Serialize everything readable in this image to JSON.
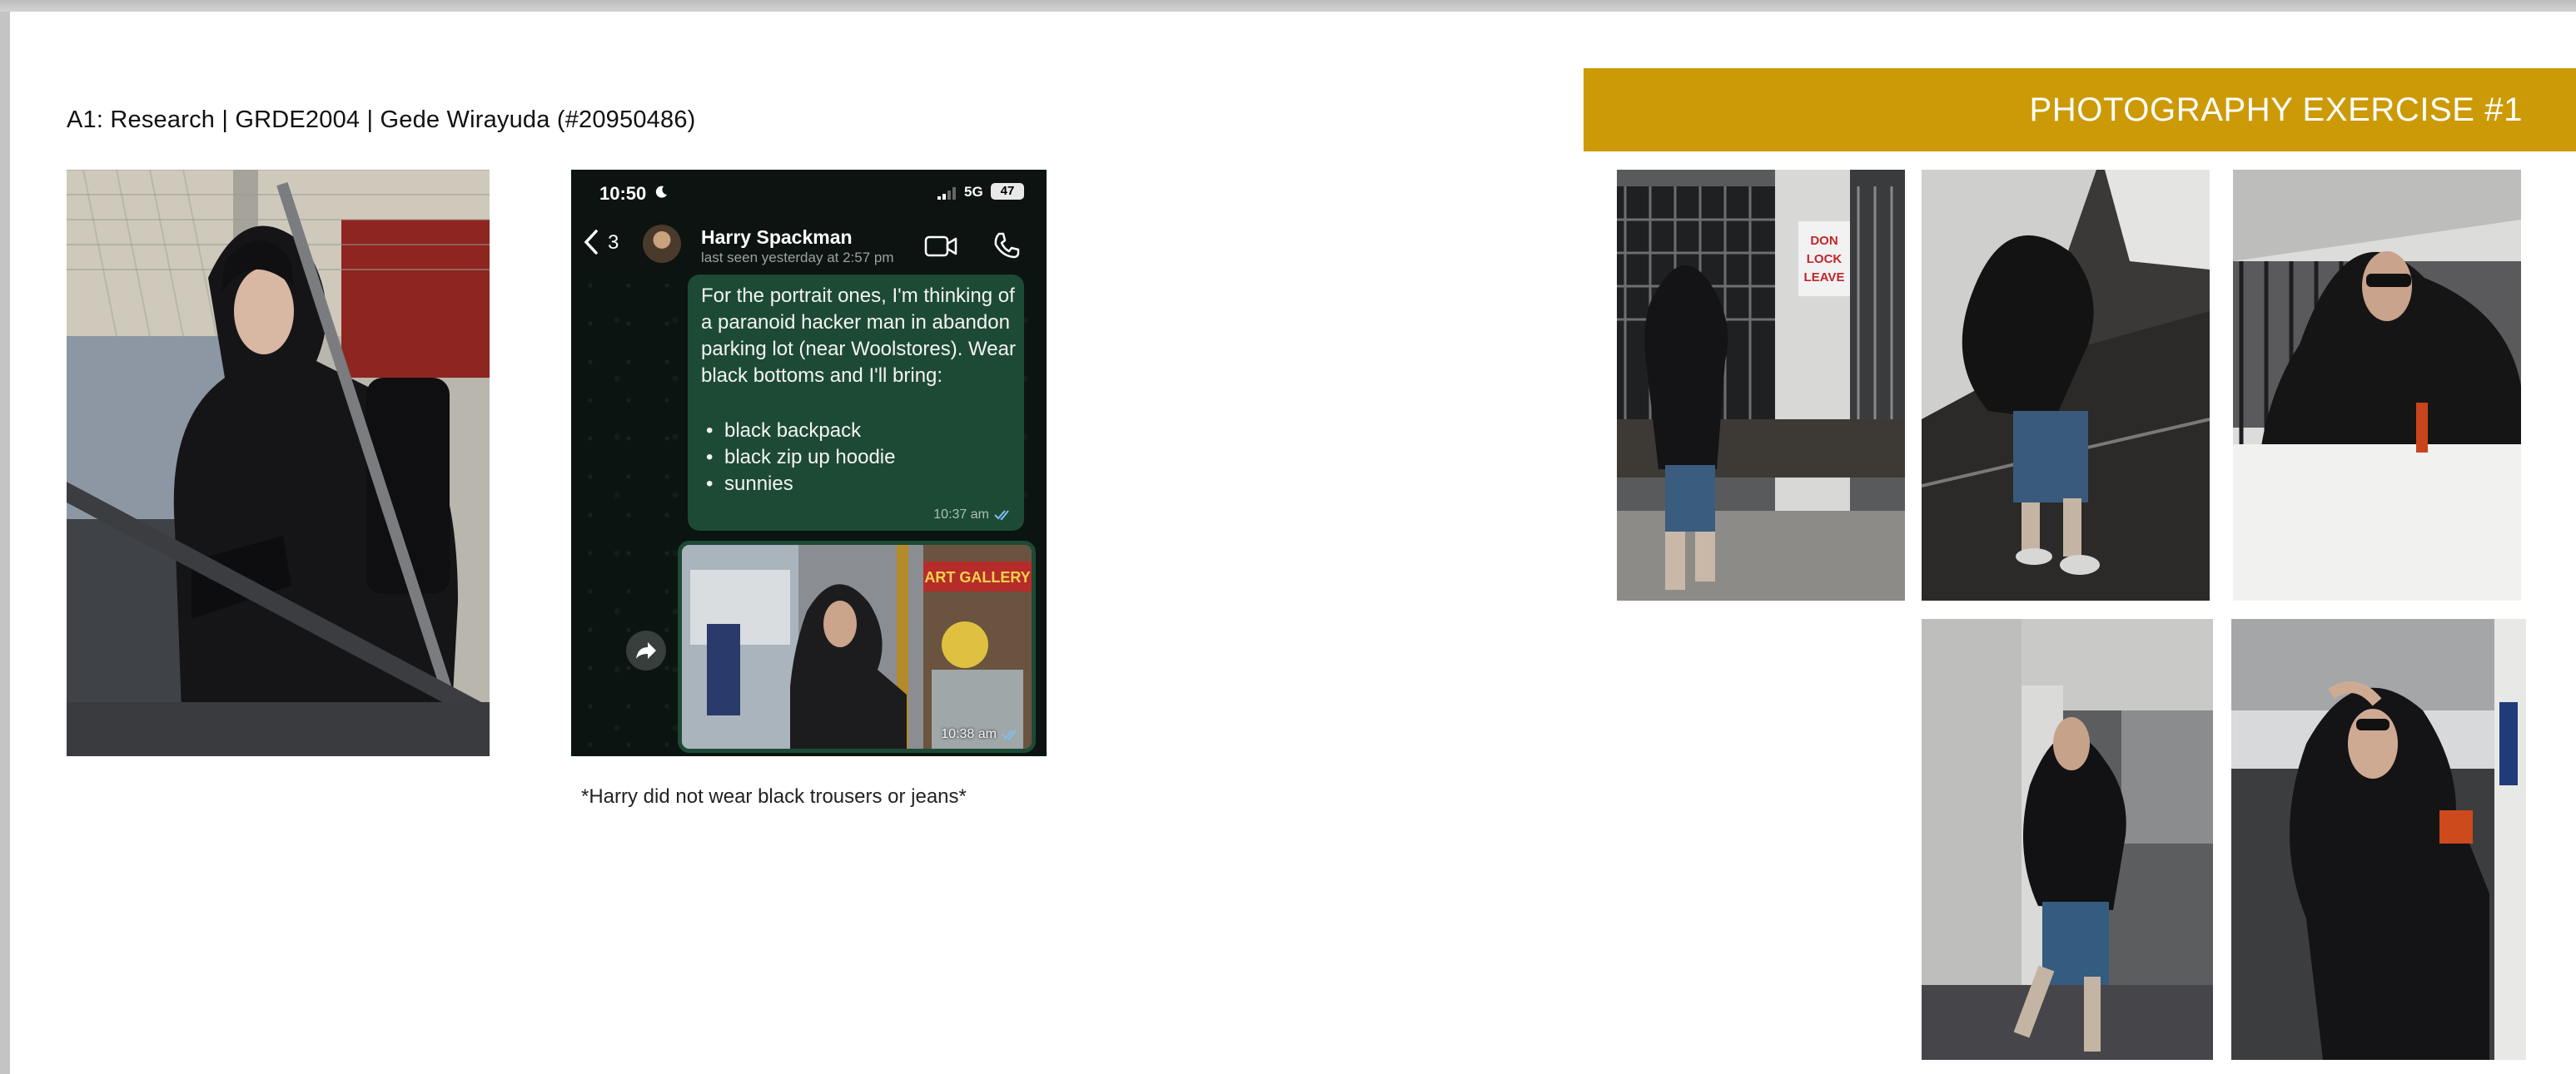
{
  "document": {
    "header": "A1: Research | GRDE2004 | Gede Wirayuda (#20950486)",
    "banner_title": "PHOTOGRAPHY EXERCISE #1",
    "banner_color": "#cc9a06",
    "caption": "*Harry did not wear black trousers or jeans*"
  },
  "phone": {
    "status_time": "10:50",
    "network": "5G",
    "battery": "47",
    "back_count": "3",
    "contact_name": "Harry Spackman",
    "contact_status": "last seen yesterday at 2:57 pm",
    "message": {
      "text": "For the portrait ones, I'm thinking of a paranoid hacker man in abandon parking lot (near Woolstores). Wear black bottoms and I'll bring:",
      "items": [
        "black backpack",
        "black zip up hoodie",
        "sunnies"
      ],
      "time": "10:37 am"
    },
    "image_message": {
      "time": "10:38 am",
      "sign_text": "ART GALLERY"
    },
    "accent_color": "#1d4a35"
  },
  "photos": {
    "sign_lines": [
      "DON",
      "LOCK",
      "LEAVE"
    ]
  }
}
